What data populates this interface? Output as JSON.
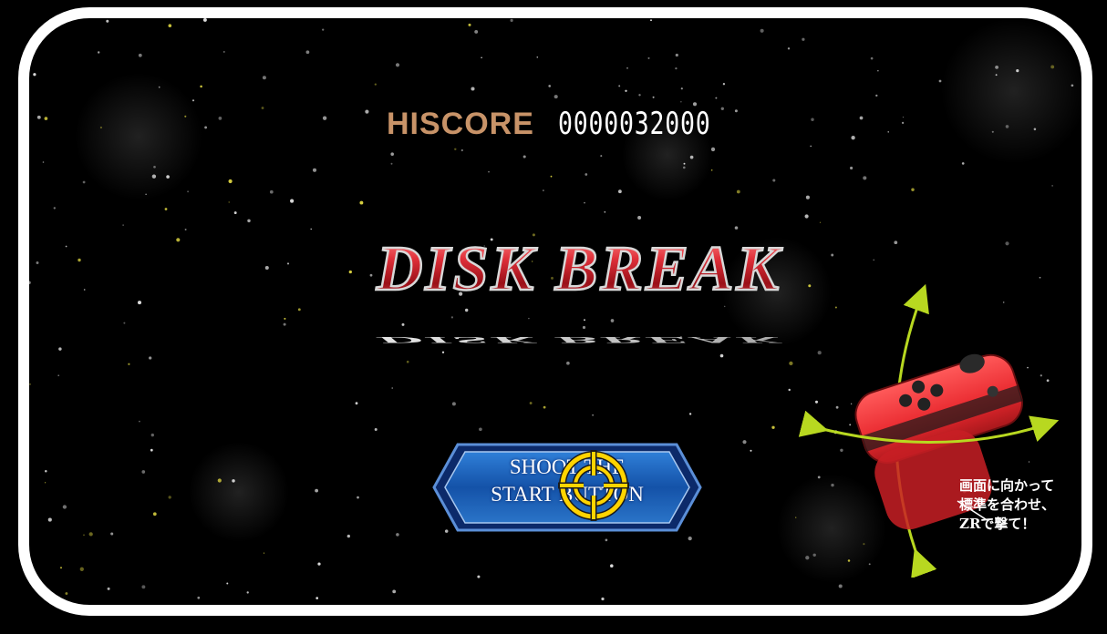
{
  "hiscore": {
    "label": "HISCORE",
    "value": "0000032000"
  },
  "title": {
    "text": "DISK BREAK",
    "color": "#c8202a"
  },
  "start_button": {
    "label": "SHOOT THE\nSTART BUTTON",
    "color": "#1a5fb4"
  },
  "crosshair": {
    "icon": "crosshair-icon",
    "color": "#ffd400"
  },
  "controller": {
    "icon": "joycon-controller-icon",
    "color": "#e8282e",
    "arrow_color": "#b8d820"
  },
  "instruction": {
    "text": "画面に向かって\n標準を合わせ、\nZRで撃て！"
  },
  "colors": {
    "frame": "#ffffff",
    "background": "#000000",
    "hiscore_label": "#c89368"
  }
}
